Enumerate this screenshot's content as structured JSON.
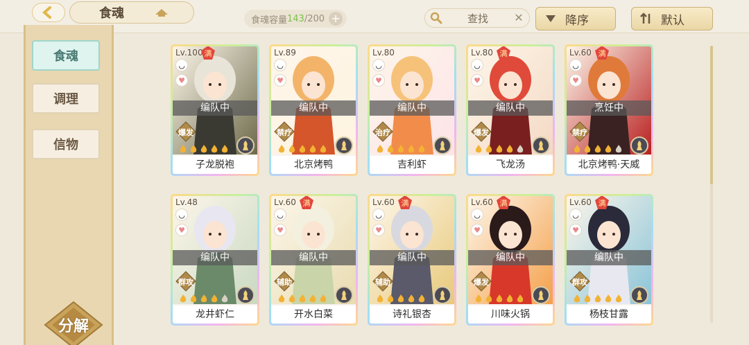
{
  "header": {
    "title": "食魂",
    "capacity_label": "食魂容量",
    "capacity_current": "143",
    "capacity_max": "/200",
    "capacity_add": "+",
    "search_label": "查找",
    "sort_order_label": "降序",
    "sort_mode_label": "默认"
  },
  "sidebar": {
    "items": [
      {
        "label": "食魂",
        "active": true
      },
      {
        "label": "调理",
        "active": false
      },
      {
        "label": "信物",
        "active": false
      }
    ],
    "decompose_label": "分解"
  },
  "cards": [
    {
      "level": "Lv.100",
      "full": true,
      "team": "编队中",
      "role": "爆发",
      "name": "子龙脱袍",
      "stars": 5,
      "palette": [
        "#e8e4d8",
        "#3a3a33",
        "#6c6a4a"
      ]
    },
    {
      "level": "Lv.89",
      "full": false,
      "team": "编队中",
      "role": "禁疗",
      "name": "北京烤鸭",
      "stars": 5,
      "palette": [
        "#f3b46a",
        "#d4562a",
        "#fff3e0"
      ]
    },
    {
      "level": "Lv.80",
      "full": false,
      "team": "编队中",
      "role": "治疗",
      "name": "吉利虾",
      "stars": 5,
      "palette": [
        "#f6c27a",
        "#f28c4a",
        "#fde3e8"
      ]
    },
    {
      "level": "Lv.80",
      "full": true,
      "team": "编队中",
      "role": "爆发",
      "name": "飞龙汤",
      "stars": 4,
      "palette": [
        "#e04a3a",
        "#7a1f1f",
        "#f4d9c4"
      ]
    },
    {
      "level": "Lv.60",
      "full": true,
      "team": "烹饪中",
      "role": "禁疗",
      "name": "北京烤鸭·天威",
      "stars": 4,
      "palette": [
        "#e07a3a",
        "#3a2222",
        "#b82020"
      ]
    },
    {
      "level": "Lv.48",
      "full": false,
      "team": "编队中",
      "role": "群攻",
      "name": "龙井虾仁",
      "stars": 4,
      "palette": [
        "#e8e6f0",
        "#6a8a6a",
        "#c9d9c2"
      ]
    },
    {
      "level": "Lv.60",
      "full": true,
      "team": "编队中",
      "role": "辅助",
      "name": "开水白菜",
      "stars": 5,
      "palette": [
        "#f4f0e0",
        "#c9d4a8",
        "#e8dcb0"
      ]
    },
    {
      "level": "Lv.60",
      "full": true,
      "team": "编队中",
      "role": "辅助",
      "name": "诗礼银杏",
      "stars": 5,
      "palette": [
        "#d8d8e0",
        "#5a5a6a",
        "#e8c97a"
      ]
    },
    {
      "level": "Lv.60",
      "full": true,
      "team": "编队中",
      "role": "爆发",
      "name": "川味火锅",
      "stars": 5,
      "palette": [
        "#2a1a1a",
        "#d8382a",
        "#f4a04a"
      ]
    },
    {
      "level": "Lv.60",
      "full": true,
      "team": "编队中",
      "role": "群攻",
      "name": "杨枝甘露",
      "stars": 5,
      "palette": [
        "#2a2a3a",
        "#e8e8f0",
        "#8ac4d8"
      ]
    }
  ]
}
